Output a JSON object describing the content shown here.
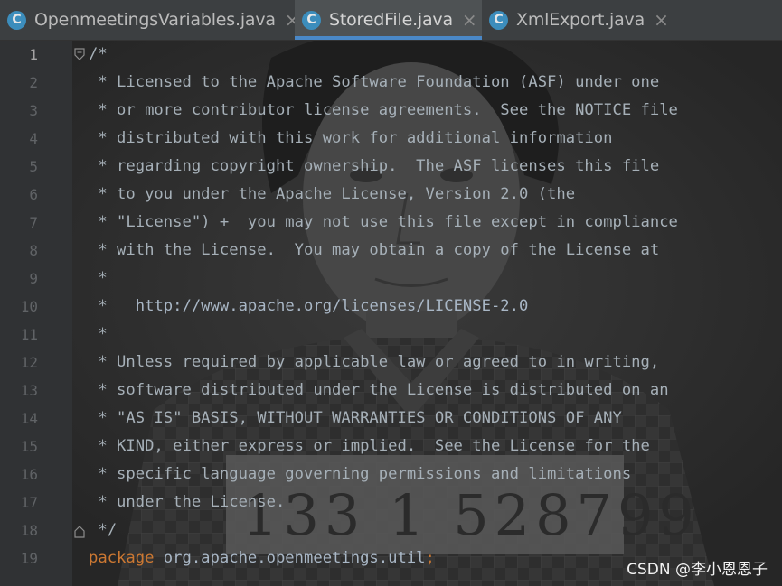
{
  "tabs": [
    {
      "icon": "C",
      "label": "OpenmeetingsVariables.java",
      "close": "×",
      "active": false
    },
    {
      "icon": "C",
      "label": "StoredFile.java",
      "close": "×",
      "active": true
    },
    {
      "icon": "C",
      "label": "XmlExport.java",
      "close": "×",
      "active": false
    }
  ],
  "gutter": {
    "line_numbers": [
      "1",
      "2",
      "3",
      "4",
      "5",
      "6",
      "7",
      "8",
      "9",
      "10",
      "11",
      "12",
      "13",
      "14",
      "15",
      "16",
      "17",
      "18",
      "19"
    ],
    "current_line": "1"
  },
  "code": {
    "line1": "/*",
    "line2": " * Licensed to the Apache Software Foundation (ASF) under one",
    "line3": " * or more contributor license agreements.  See the NOTICE file",
    "line4": " * distributed with this work for additional information",
    "line5": " * regarding copyright ownership.  The ASF licenses this file",
    "line6": " * to you under the Apache License, Version 2.0 (the",
    "line7": " * \"License\") +  you may not use this file except in compliance",
    "line8": " * with the License.  You may obtain a copy of the License at",
    "line9": " *",
    "line10_prefix": " *   ",
    "line10_link": "http://www.apache.org/licenses/LICENSE-2.0",
    "line11": " *",
    "line12": " * Unless required by applicable law or agreed to in writing,",
    "line13": " * software distributed under the License is distributed on an",
    "line14": " * \"AS IS\" BASIS, WITHOUT WARRANTIES OR CONDITIONS OF ANY",
    "line15": " * KIND, either express or implied.  See the License for the",
    "line16": " * specific language governing permissions and limitations",
    "line17": " * under the License.",
    "line18": " */",
    "line19_keyword": "package",
    "line19_package": " org.apache.openmeetings.util",
    "line19_semicolon": ";"
  },
  "background_picture": {
    "placard_text": "133 1 528799"
  },
  "watermark": "CSDN @李小恩恩子",
  "colors": {
    "editor_bg": "#2b2b2b",
    "tabbar_bg": "#3c3f41",
    "active_tab_underline": "#4a88c7",
    "class_icon": "#3c8dbc",
    "keyword": "#cc7832",
    "comment": "#a6b0b8",
    "line_number": "#606366"
  }
}
